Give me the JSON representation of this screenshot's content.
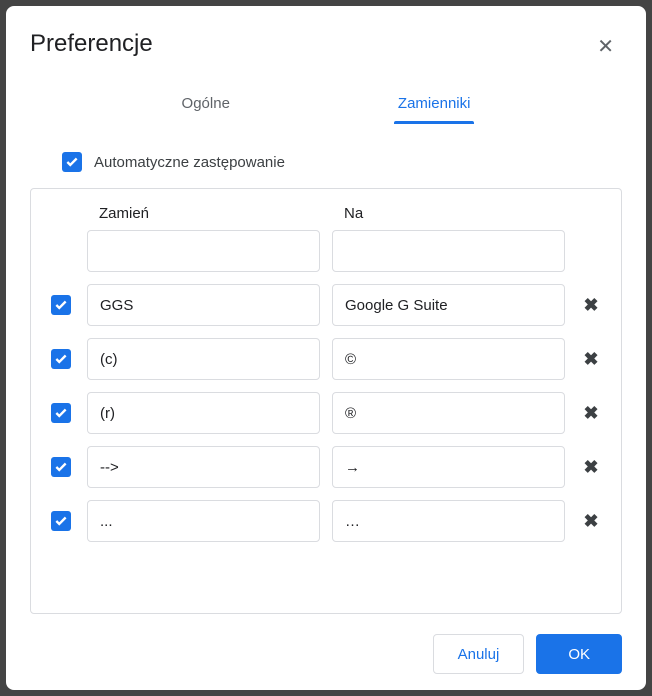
{
  "dialog": {
    "title": "Preferencje",
    "tabs": {
      "general": "Ogólne",
      "substitutions": "Zamienniki"
    },
    "autoReplace": "Automatyczne zastępowanie",
    "columns": {
      "replace": "Zamień",
      "with": "Na"
    },
    "rows": [
      {
        "checked": false,
        "replace": "",
        "with": "",
        "deletable": false
      },
      {
        "checked": true,
        "replace": "GGS",
        "with": "Google G Suite",
        "deletable": true
      },
      {
        "checked": true,
        "replace": "(c)",
        "with": "©",
        "deletable": true
      },
      {
        "checked": true,
        "replace": "(r)",
        "with": "®",
        "deletable": true
      },
      {
        "checked": true,
        "replace": "-->",
        "with": "→",
        "deletable": true
      },
      {
        "checked": true,
        "replace": "...",
        "with": "…",
        "deletable": true
      }
    ],
    "buttons": {
      "cancel": "Anuluj",
      "ok": "OK"
    }
  }
}
